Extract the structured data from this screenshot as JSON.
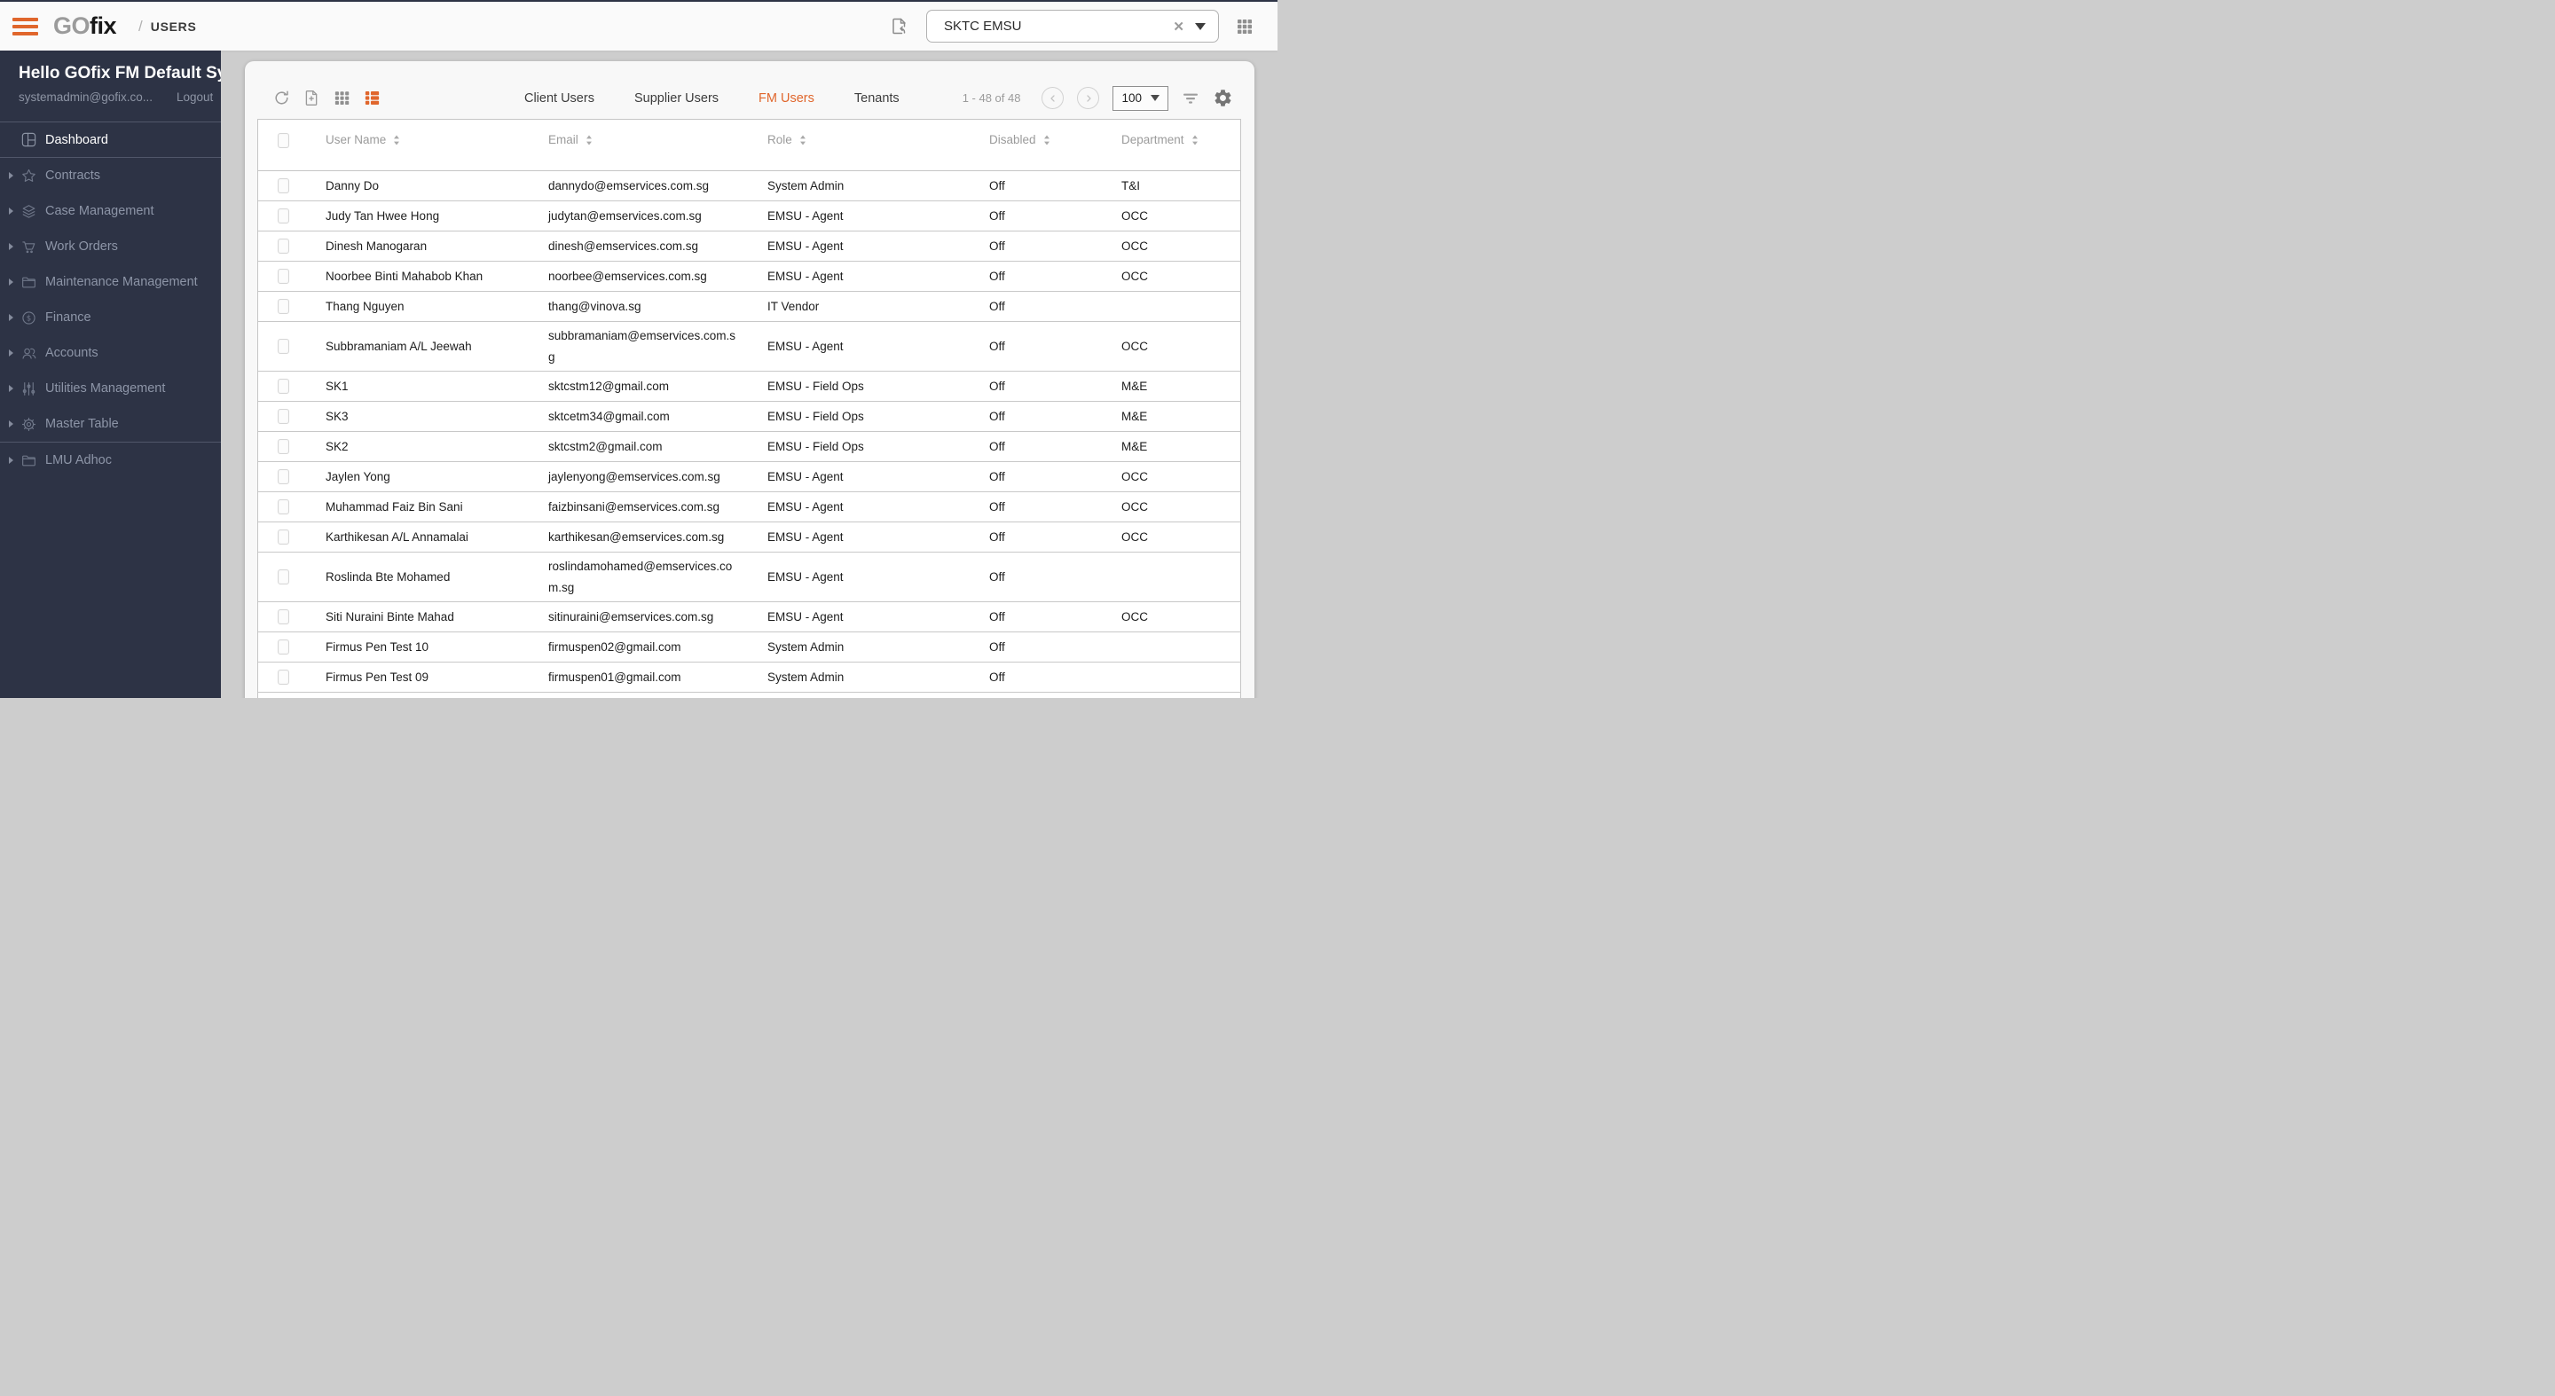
{
  "colors": {
    "accent_orange": "#e0662c",
    "sidebar_bg": "#2d3345",
    "sidebar_text": "#8d95a7",
    "topbar_bg": "#fafafa",
    "content_bg": "#cdcdcd",
    "card_bg": "#f8f8f8",
    "row_border": "#c8c8c8",
    "table_header_text": "#9b9b9b"
  },
  "header": {
    "logo_go": "GO",
    "logo_fix": "fix",
    "breadcrumb_separator": "/",
    "breadcrumb": "USERS",
    "org_selector": {
      "value": "SKTC EMSU",
      "clear_glyph": "✕"
    }
  },
  "sidebar": {
    "greeting": "Hello GOfix FM Default Sy",
    "email": "systemadmin@gofix.co...",
    "logout_label": "Logout",
    "items": [
      {
        "label": "Dashboard",
        "icon": "dashboard-icon",
        "active": true,
        "expandable": false
      },
      {
        "label": "Contracts",
        "icon": "star-icon",
        "expandable": true
      },
      {
        "label": "Case Management",
        "icon": "layers-icon",
        "expandable": true
      },
      {
        "label": "Work Orders",
        "icon": "cart-icon",
        "expandable": true
      },
      {
        "label": "Maintenance Management",
        "icon": "folder-icon",
        "expandable": true
      },
      {
        "label": "Finance",
        "icon": "dollar-icon",
        "expandable": true
      },
      {
        "label": "Accounts",
        "icon": "people-icon",
        "expandable": true
      },
      {
        "label": "Utilities Management",
        "icon": "sliders-icon",
        "expandable": true
      },
      {
        "label": "Master Table",
        "icon": "gear-icon",
        "expandable": true
      },
      {
        "label": "LMU Adhoc",
        "icon": "folder-icon",
        "expandable": true,
        "divider_before": true
      }
    ]
  },
  "toolbar": {
    "tabs": [
      {
        "label": "Client Users"
      },
      {
        "label": "Supplier Users"
      },
      {
        "label": "FM Users",
        "active": true
      },
      {
        "label": "Tenants"
      }
    ],
    "pagination": {
      "range": "1 - 48 of 48",
      "page_size": "100"
    }
  },
  "table": {
    "columns": [
      "User Name",
      "Email",
      "Role",
      "Disabled",
      "Department"
    ],
    "rows": [
      {
        "name": "Danny Do",
        "email": "dannydo@emservices.com.sg",
        "role": "System Admin",
        "disabled": "Off",
        "department": "T&I"
      },
      {
        "name": "Judy Tan Hwee Hong",
        "email": "judytan@emservices.com.sg",
        "role": "EMSU - Agent",
        "disabled": "Off",
        "department": "OCC"
      },
      {
        "name": "Dinesh Manogaran",
        "email": "dinesh@emservices.com.sg",
        "role": "EMSU - Agent",
        "disabled": "Off",
        "department": "OCC"
      },
      {
        "name": "Noorbee Binti Mahabob Khan",
        "email": "noorbee@emservices.com.sg",
        "role": "EMSU - Agent",
        "disabled": "Off",
        "department": "OCC"
      },
      {
        "name": "Thang Nguyen",
        "email": "thang@vinova.sg",
        "role": "IT Vendor",
        "disabled": "Off",
        "department": ""
      },
      {
        "name": "Subbramaniam A/L Jeewah",
        "email": "subbramaniam@emservices.com.sg",
        "role": "EMSU - Agent",
        "disabled": "Off",
        "department": "OCC",
        "tall": true
      },
      {
        "name": "SK1",
        "email": "sktcstm12@gmail.com",
        "role": "EMSU - Field Ops",
        "disabled": "Off",
        "department": "M&E"
      },
      {
        "name": "SK3",
        "email": "sktcetm34@gmail.com",
        "role": "EMSU - Field Ops",
        "disabled": "Off",
        "department": "M&E"
      },
      {
        "name": "SK2",
        "email": "sktcstm2@gmail.com",
        "role": "EMSU - Field Ops",
        "disabled": "Off",
        "department": "M&E"
      },
      {
        "name": "Jaylen Yong",
        "email": "jaylenyong@emservices.com.sg",
        "role": "EMSU - Agent",
        "disabled": "Off",
        "department": "OCC"
      },
      {
        "name": "Muhammad Faiz Bin Sani",
        "email": "faizbinsani@emservices.com.sg",
        "role": "EMSU - Agent",
        "disabled": "Off",
        "department": "OCC"
      },
      {
        "name": "Karthikesan A/L Annamalai",
        "email": "karthikesan@emservices.com.sg",
        "role": "EMSU - Agent",
        "disabled": "Off",
        "department": "OCC"
      },
      {
        "name": "Roslinda Bte Mohamed",
        "email": "roslindamohamed@emservices.com.sg",
        "role": "EMSU - Agent",
        "disabled": "Off",
        "department": "",
        "tall": true
      },
      {
        "name": "Siti Nuraini Binte Mahad",
        "email": "sitinuraini@emservices.com.sg",
        "role": "EMSU - Agent",
        "disabled": "Off",
        "department": "OCC"
      },
      {
        "name": "Firmus Pen Test 10",
        "email": "firmuspen02@gmail.com",
        "role": "System Admin",
        "disabled": "Off",
        "department": ""
      },
      {
        "name": "Firmus Pen Test 09",
        "email": "firmuspen01@gmail.com",
        "role": "System Admin",
        "disabled": "Off",
        "department": ""
      }
    ]
  }
}
